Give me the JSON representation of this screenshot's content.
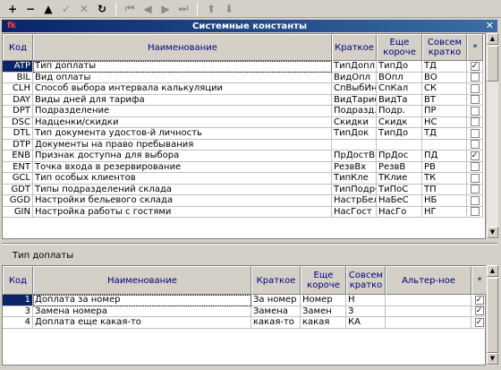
{
  "toolbar": {
    "buttons": [
      {
        "icon": "plus-icon",
        "glyph": "+"
      },
      {
        "icon": "minus-icon",
        "glyph": "−"
      },
      {
        "icon": "triangle-up-icon",
        "glyph": "▲"
      },
      {
        "icon": "check-icon",
        "glyph": "✓"
      },
      {
        "icon": "cancel-icon",
        "glyph": "✕"
      },
      {
        "icon": "refresh-icon",
        "glyph": "↻"
      },
      {
        "icon": "first-record-icon",
        "glyph": "⏮"
      },
      {
        "icon": "prev-record-icon",
        "glyph": "◀"
      },
      {
        "icon": "next-record-icon",
        "glyph": "▶"
      },
      {
        "icon": "last-record-icon",
        "glyph": "⏭"
      },
      {
        "icon": "arrow-up-icon",
        "glyph": "⬆"
      },
      {
        "icon": "arrow-down-icon",
        "glyph": "⬇"
      }
    ]
  },
  "window": {
    "title": "Системные константы",
    "app_icon": "fk",
    "close_glyph": "✕"
  },
  "main_grid": {
    "headers": [
      "Код",
      "Наименование",
      "Краткое",
      "Еще короче",
      "Совсем кратко",
      "*"
    ],
    "rows": [
      {
        "code": "ATP",
        "name": "Тип доплаты",
        "short": "ТипДопл",
        "shorter": "ТипДо",
        "shortest": "ТД",
        "checked": true,
        "selected": true
      },
      {
        "code": "BIL",
        "name": "Вид оплаты",
        "short": "ВидОпл",
        "shorter": "ВОпл",
        "shortest": "ВО",
        "checked": false
      },
      {
        "code": "CLH",
        "name": "Способ выбора интервала калькуляции",
        "short": "СпВыбИн",
        "shorter": "СпКал",
        "shortest": "СК",
        "checked": false
      },
      {
        "code": "DAY",
        "name": "Виды дней для тарифа",
        "short": "ВидТарифа",
        "shorter": "ВидТа",
        "shortest": "ВТ",
        "checked": false
      },
      {
        "code": "DPT",
        "name": "Подразделение",
        "short": "Подразд.",
        "shorter": "Подр.",
        "shortest": "ПР",
        "checked": false
      },
      {
        "code": "DSC",
        "name": "Надценки/скидки",
        "short": "Скидки",
        "shorter": "Скидк",
        "shortest": "НС",
        "checked": false
      },
      {
        "code": "DTL",
        "name": "Тип документа удостов-й личность",
        "short": "ТипДок",
        "shorter": "ТипДо",
        "shortest": "ТД",
        "checked": false
      },
      {
        "code": "DTP",
        "name": "Документы на право пребывания",
        "short": "",
        "shorter": "",
        "shortest": "",
        "checked": false
      },
      {
        "code": "ENB",
        "name": "Признак доступна для выбора",
        "short": "ПрДостВы",
        "shorter": "ПрДос",
        "shortest": "ПД",
        "checked": true
      },
      {
        "code": "ENT",
        "name": "Точка входа в резервирование",
        "short": "РезвВх",
        "shorter": "РезвВ",
        "shortest": "РВ",
        "checked": false
      },
      {
        "code": "GCL",
        "name": "Тип особых клиентов",
        "short": "ТипКле",
        "shorter": "ТКлие",
        "shortest": "ТК",
        "checked": false
      },
      {
        "code": "GDT",
        "name": "Типы подразделений склада",
        "short": "ТипПодрСкл",
        "shorter": "ТиПоС",
        "shortest": "ТП",
        "checked": false
      },
      {
        "code": "GGD",
        "name": "Настройки бельевого склада",
        "short": "НастрБельС",
        "shorter": "НаБеС",
        "shortest": "НБ",
        "checked": false
      },
      {
        "code": "GIN",
        "name": "Настройка работы с гостями",
        "short": "НасГост",
        "shorter": "НасГо",
        "shortest": "НГ",
        "checked": false
      }
    ]
  },
  "detail": {
    "label": "Тип доплаты",
    "headers": [
      "Код",
      "Наименование",
      "Краткое",
      "Еще короче",
      "Совсем кратко",
      "Альтер-ное",
      "*"
    ],
    "rows": [
      {
        "code": "1",
        "name": "Доплата за номер",
        "short": "За номер",
        "shorter": "Номер",
        "shortest": "Н",
        "alt": "",
        "checked": true,
        "selected": true
      },
      {
        "code": "3",
        "name": "Замена номера",
        "short": "Замена",
        "shorter": "Замен",
        "shortest": "З",
        "alt": "",
        "checked": true
      },
      {
        "code": "4",
        "name": "Доплата еще какая-то",
        "short": "какая-то",
        "shorter": "какая",
        "shortest": "КА",
        "alt": "",
        "checked": true
      }
    ]
  },
  "colors": {
    "title_gradient_start": "#0a246a",
    "title_gradient_end": "#3a6ea5",
    "header_text": "#00007b",
    "selection": "#0a246a",
    "window_bg": "#d4d0c8"
  }
}
